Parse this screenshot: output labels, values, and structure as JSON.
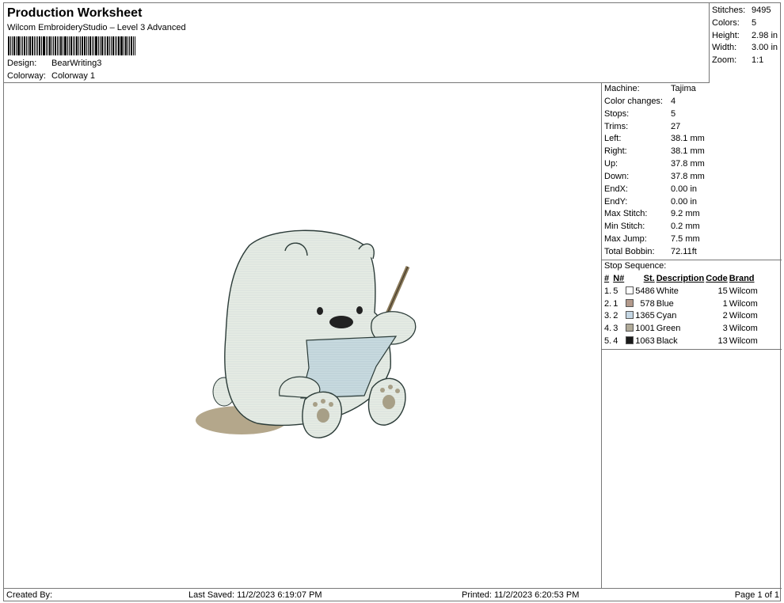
{
  "header": {
    "title": "Production Worksheet",
    "subtitle": "Wilcom EmbroideryStudio – Level 3 Advanced",
    "design_label": "Design:",
    "design_value": "BearWriting3",
    "colorway_label": "Colorway:",
    "colorway_value": "Colorway 1"
  },
  "summary": [
    {
      "label": "Stitches:",
      "value": "9495"
    },
    {
      "label": "Colors:",
      "value": "5"
    },
    {
      "label": "Height:",
      "value": "2.98 in"
    },
    {
      "label": "Width:",
      "value": "3.00 in"
    },
    {
      "label": "Zoom:",
      "value": "1:1"
    }
  ],
  "params": [
    {
      "label": "Machine:",
      "value": "Tajima"
    },
    {
      "label": "Color changes:",
      "value": "4"
    },
    {
      "label": "Stops:",
      "value": "5"
    },
    {
      "label": "Trims:",
      "value": "27"
    },
    {
      "label": "Left:",
      "value": "38.1 mm"
    },
    {
      "label": "Right:",
      "value": "38.1 mm"
    },
    {
      "label": "Up:",
      "value": "37.8 mm"
    },
    {
      "label": "Down:",
      "value": "37.8 mm"
    },
    {
      "label": "EndX:",
      "value": "0.00 in"
    },
    {
      "label": "EndY:",
      "value": "0.00 in"
    },
    {
      "label": "Max Stitch:",
      "value": "9.2 mm"
    },
    {
      "label": "Min Stitch:",
      "value": "0.2 mm"
    },
    {
      "label": "Max Jump:",
      "value": "7.5 mm"
    },
    {
      "label": "Total Bobbin:",
      "value": "72.11ft"
    }
  ],
  "sequence": {
    "title": "Stop Sequence:",
    "headers": {
      "num": "#",
      "n": "N#",
      "st": "St.",
      "desc": "Description",
      "code": "Code",
      "brand": "Brand"
    },
    "rows": [
      {
        "num": "1.",
        "n": "5",
        "color": "#ffffff",
        "st": "5486",
        "desc": "White",
        "code": "15",
        "brand": "Wilcom"
      },
      {
        "num": "2.",
        "n": "1",
        "color": "#b39a8c",
        "st": "578",
        "desc": "Blue",
        "code": "1",
        "brand": "Wilcom"
      },
      {
        "num": "3.",
        "n": "2",
        "color": "#c4d6e3",
        "st": "1365",
        "desc": "Cyan",
        "code": "2",
        "brand": "Wilcom"
      },
      {
        "num": "4.",
        "n": "3",
        "color": "#b0aa98",
        "st": "1001",
        "desc": "Green",
        "code": "3",
        "brand": "Wilcom"
      },
      {
        "num": "5.",
        "n": "4",
        "color": "#1a1a1a",
        "st": "1063",
        "desc": "Black",
        "code": "13",
        "brand": "Wilcom"
      }
    ]
  },
  "footer": {
    "created": "Created By:",
    "saved": "Last Saved: 11/2/2023 6:19:07 PM",
    "printed": "Printed: 11/2/2023 6:20:53 PM",
    "page": "Page 1 of 1"
  },
  "colors": {
    "border": "#777777",
    "bear_fill": "#e4ebe3",
    "bear_shadow": "#b7ab8f",
    "paper": "#c6d8df",
    "paw_pad": "#a79f87"
  }
}
